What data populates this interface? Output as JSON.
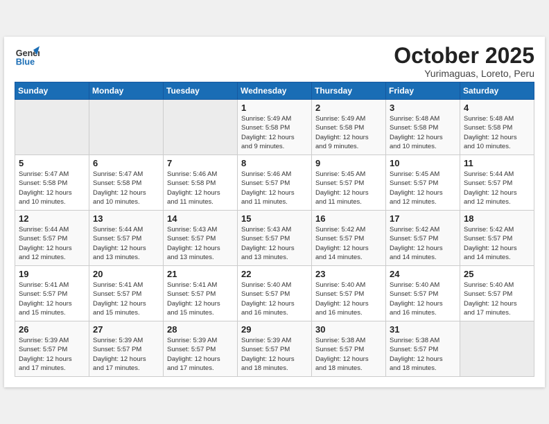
{
  "header": {
    "logo_line1": "General",
    "logo_line2": "Blue",
    "month": "October 2025",
    "location": "Yurimaguas, Loreto, Peru"
  },
  "weekdays": [
    "Sunday",
    "Monday",
    "Tuesday",
    "Wednesday",
    "Thursday",
    "Friday",
    "Saturday"
  ],
  "weeks": [
    [
      {
        "day": "",
        "info": ""
      },
      {
        "day": "",
        "info": ""
      },
      {
        "day": "",
        "info": ""
      },
      {
        "day": "1",
        "info": "Sunrise: 5:49 AM\nSunset: 5:58 PM\nDaylight: 12 hours\nand 9 minutes."
      },
      {
        "day": "2",
        "info": "Sunrise: 5:49 AM\nSunset: 5:58 PM\nDaylight: 12 hours\nand 9 minutes."
      },
      {
        "day": "3",
        "info": "Sunrise: 5:48 AM\nSunset: 5:58 PM\nDaylight: 12 hours\nand 10 minutes."
      },
      {
        "day": "4",
        "info": "Sunrise: 5:48 AM\nSunset: 5:58 PM\nDaylight: 12 hours\nand 10 minutes."
      }
    ],
    [
      {
        "day": "5",
        "info": "Sunrise: 5:47 AM\nSunset: 5:58 PM\nDaylight: 12 hours\nand 10 minutes."
      },
      {
        "day": "6",
        "info": "Sunrise: 5:47 AM\nSunset: 5:58 PM\nDaylight: 12 hours\nand 10 minutes."
      },
      {
        "day": "7",
        "info": "Sunrise: 5:46 AM\nSunset: 5:58 PM\nDaylight: 12 hours\nand 11 minutes."
      },
      {
        "day": "8",
        "info": "Sunrise: 5:46 AM\nSunset: 5:57 PM\nDaylight: 12 hours\nand 11 minutes."
      },
      {
        "day": "9",
        "info": "Sunrise: 5:45 AM\nSunset: 5:57 PM\nDaylight: 12 hours\nand 11 minutes."
      },
      {
        "day": "10",
        "info": "Sunrise: 5:45 AM\nSunset: 5:57 PM\nDaylight: 12 hours\nand 12 minutes."
      },
      {
        "day": "11",
        "info": "Sunrise: 5:44 AM\nSunset: 5:57 PM\nDaylight: 12 hours\nand 12 minutes."
      }
    ],
    [
      {
        "day": "12",
        "info": "Sunrise: 5:44 AM\nSunset: 5:57 PM\nDaylight: 12 hours\nand 12 minutes."
      },
      {
        "day": "13",
        "info": "Sunrise: 5:44 AM\nSunset: 5:57 PM\nDaylight: 12 hours\nand 13 minutes."
      },
      {
        "day": "14",
        "info": "Sunrise: 5:43 AM\nSunset: 5:57 PM\nDaylight: 12 hours\nand 13 minutes."
      },
      {
        "day": "15",
        "info": "Sunrise: 5:43 AM\nSunset: 5:57 PM\nDaylight: 12 hours\nand 13 minutes."
      },
      {
        "day": "16",
        "info": "Sunrise: 5:42 AM\nSunset: 5:57 PM\nDaylight: 12 hours\nand 14 minutes."
      },
      {
        "day": "17",
        "info": "Sunrise: 5:42 AM\nSunset: 5:57 PM\nDaylight: 12 hours\nand 14 minutes."
      },
      {
        "day": "18",
        "info": "Sunrise: 5:42 AM\nSunset: 5:57 PM\nDaylight: 12 hours\nand 14 minutes."
      }
    ],
    [
      {
        "day": "19",
        "info": "Sunrise: 5:41 AM\nSunset: 5:57 PM\nDaylight: 12 hours\nand 15 minutes."
      },
      {
        "day": "20",
        "info": "Sunrise: 5:41 AM\nSunset: 5:57 PM\nDaylight: 12 hours\nand 15 minutes."
      },
      {
        "day": "21",
        "info": "Sunrise: 5:41 AM\nSunset: 5:57 PM\nDaylight: 12 hours\nand 15 minutes."
      },
      {
        "day": "22",
        "info": "Sunrise: 5:40 AM\nSunset: 5:57 PM\nDaylight: 12 hours\nand 16 minutes."
      },
      {
        "day": "23",
        "info": "Sunrise: 5:40 AM\nSunset: 5:57 PM\nDaylight: 12 hours\nand 16 minutes."
      },
      {
        "day": "24",
        "info": "Sunrise: 5:40 AM\nSunset: 5:57 PM\nDaylight: 12 hours\nand 16 minutes."
      },
      {
        "day": "25",
        "info": "Sunrise: 5:40 AM\nSunset: 5:57 PM\nDaylight: 12 hours\nand 17 minutes."
      }
    ],
    [
      {
        "day": "26",
        "info": "Sunrise: 5:39 AM\nSunset: 5:57 PM\nDaylight: 12 hours\nand 17 minutes."
      },
      {
        "day": "27",
        "info": "Sunrise: 5:39 AM\nSunset: 5:57 PM\nDaylight: 12 hours\nand 17 minutes."
      },
      {
        "day": "28",
        "info": "Sunrise: 5:39 AM\nSunset: 5:57 PM\nDaylight: 12 hours\nand 17 minutes."
      },
      {
        "day": "29",
        "info": "Sunrise: 5:39 AM\nSunset: 5:57 PM\nDaylight: 12 hours\nand 18 minutes."
      },
      {
        "day": "30",
        "info": "Sunrise: 5:38 AM\nSunset: 5:57 PM\nDaylight: 12 hours\nand 18 minutes."
      },
      {
        "day": "31",
        "info": "Sunrise: 5:38 AM\nSunset: 5:57 PM\nDaylight: 12 hours\nand 18 minutes."
      },
      {
        "day": "",
        "info": ""
      }
    ]
  ]
}
